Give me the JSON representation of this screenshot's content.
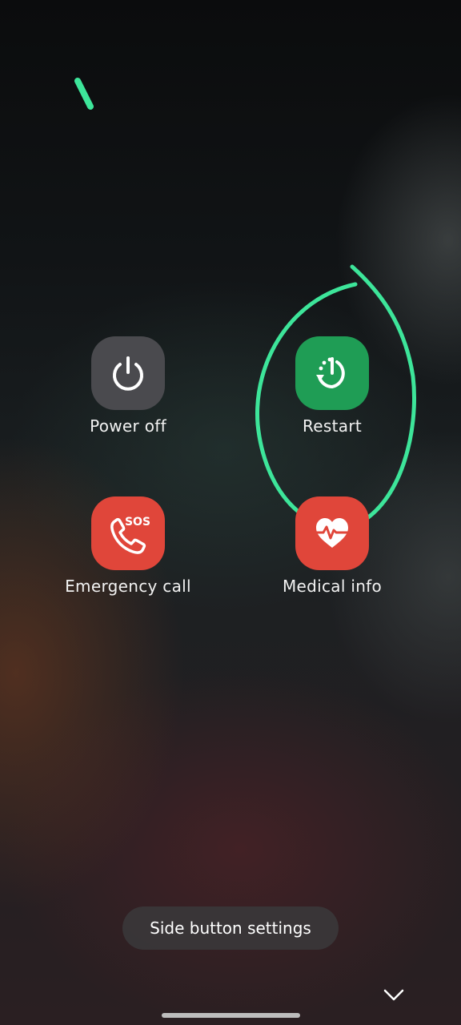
{
  "power_menu": {
    "power_off": {
      "label": "Power off",
      "icon": "power-icon",
      "color": "#4a4a4e"
    },
    "restart": {
      "label": "Restart",
      "icon": "restart-icon",
      "color": "#1f9d55"
    },
    "emergency_call": {
      "label": "Emergency call",
      "icon": "sos-phone-icon",
      "badge": "SOS",
      "color": "#e0463a"
    },
    "medical_info": {
      "label": "Medical info",
      "icon": "heart-pulse-icon",
      "color": "#e0463a"
    }
  },
  "side_button_settings": {
    "label": "Side button settings"
  },
  "nav": {
    "collapse_icon": "chevron-down-icon",
    "home_indicator": "gesture-bar"
  },
  "annotation": {
    "color": "#3de59a"
  }
}
